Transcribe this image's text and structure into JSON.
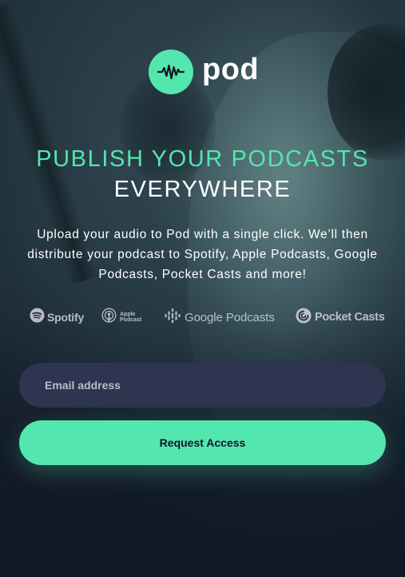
{
  "brand": {
    "name": "pod",
    "icon": "waveform-icon",
    "accent_color": "#54e6af"
  },
  "hero": {
    "headline_accent": "PUBLISH YOUR PODCASTS",
    "headline_rest": "EVERYWHERE",
    "description": "Upload your audio to Pod with a single click. We’ll then distribute your podcast to Spotify, Apple Podcasts, Google Podcasts, Pocket Casts and more!"
  },
  "partners": [
    {
      "name": "Spotify",
      "icon": "spotify-icon"
    },
    {
      "name": "Apple Podcast",
      "line1": "Apple",
      "line2": "Podcast",
      "icon": "apple-podcasts-icon"
    },
    {
      "name": "Google Podcasts",
      "icon": "google-podcasts-icon"
    },
    {
      "name": "Pocket Casts",
      "icon": "pocket-casts-icon"
    }
  ],
  "form": {
    "email_placeholder": "Email address",
    "email_value": "",
    "submit_label": "Request Access"
  },
  "colors": {
    "background": "#121725",
    "input_background": "#2f3550",
    "accent": "#54e6af"
  }
}
